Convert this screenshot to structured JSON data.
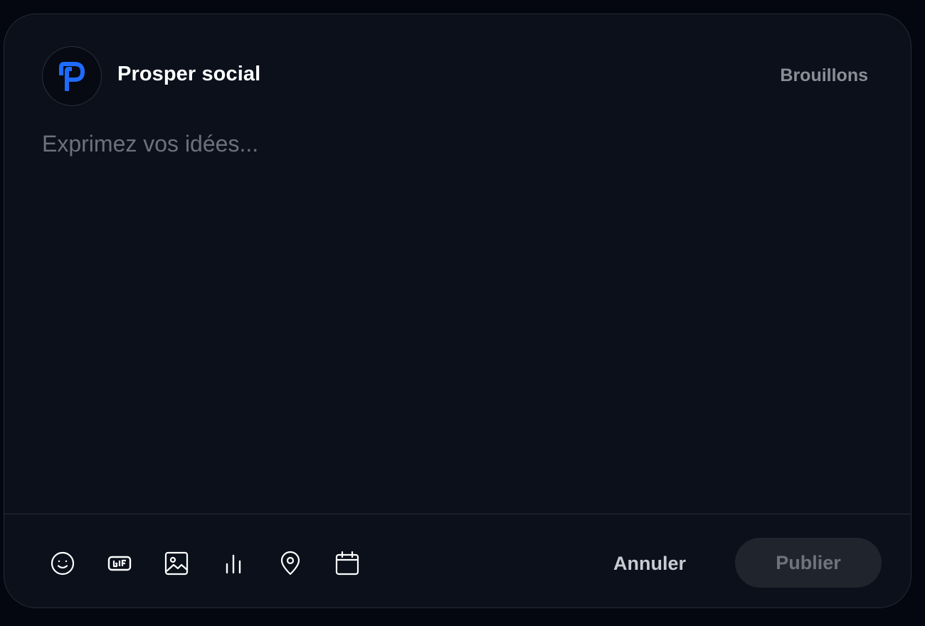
{
  "header": {
    "account_name": "Prosper social",
    "drafts_label": "Brouillons"
  },
  "composer": {
    "placeholder": "Exprimez vos idées...",
    "value": ""
  },
  "toolbar": {
    "icons": [
      "emoji-icon",
      "gif-icon",
      "image-icon",
      "poll-icon",
      "location-icon",
      "calendar-icon"
    ]
  },
  "actions": {
    "cancel_label": "Annuler",
    "publish_label": "Publier"
  },
  "colors": {
    "background": "#04070f",
    "panel": "#0b101b",
    "brand": "#1f6bff",
    "muted_text": "#8a8e96",
    "publish_disabled_bg": "#20242c"
  }
}
